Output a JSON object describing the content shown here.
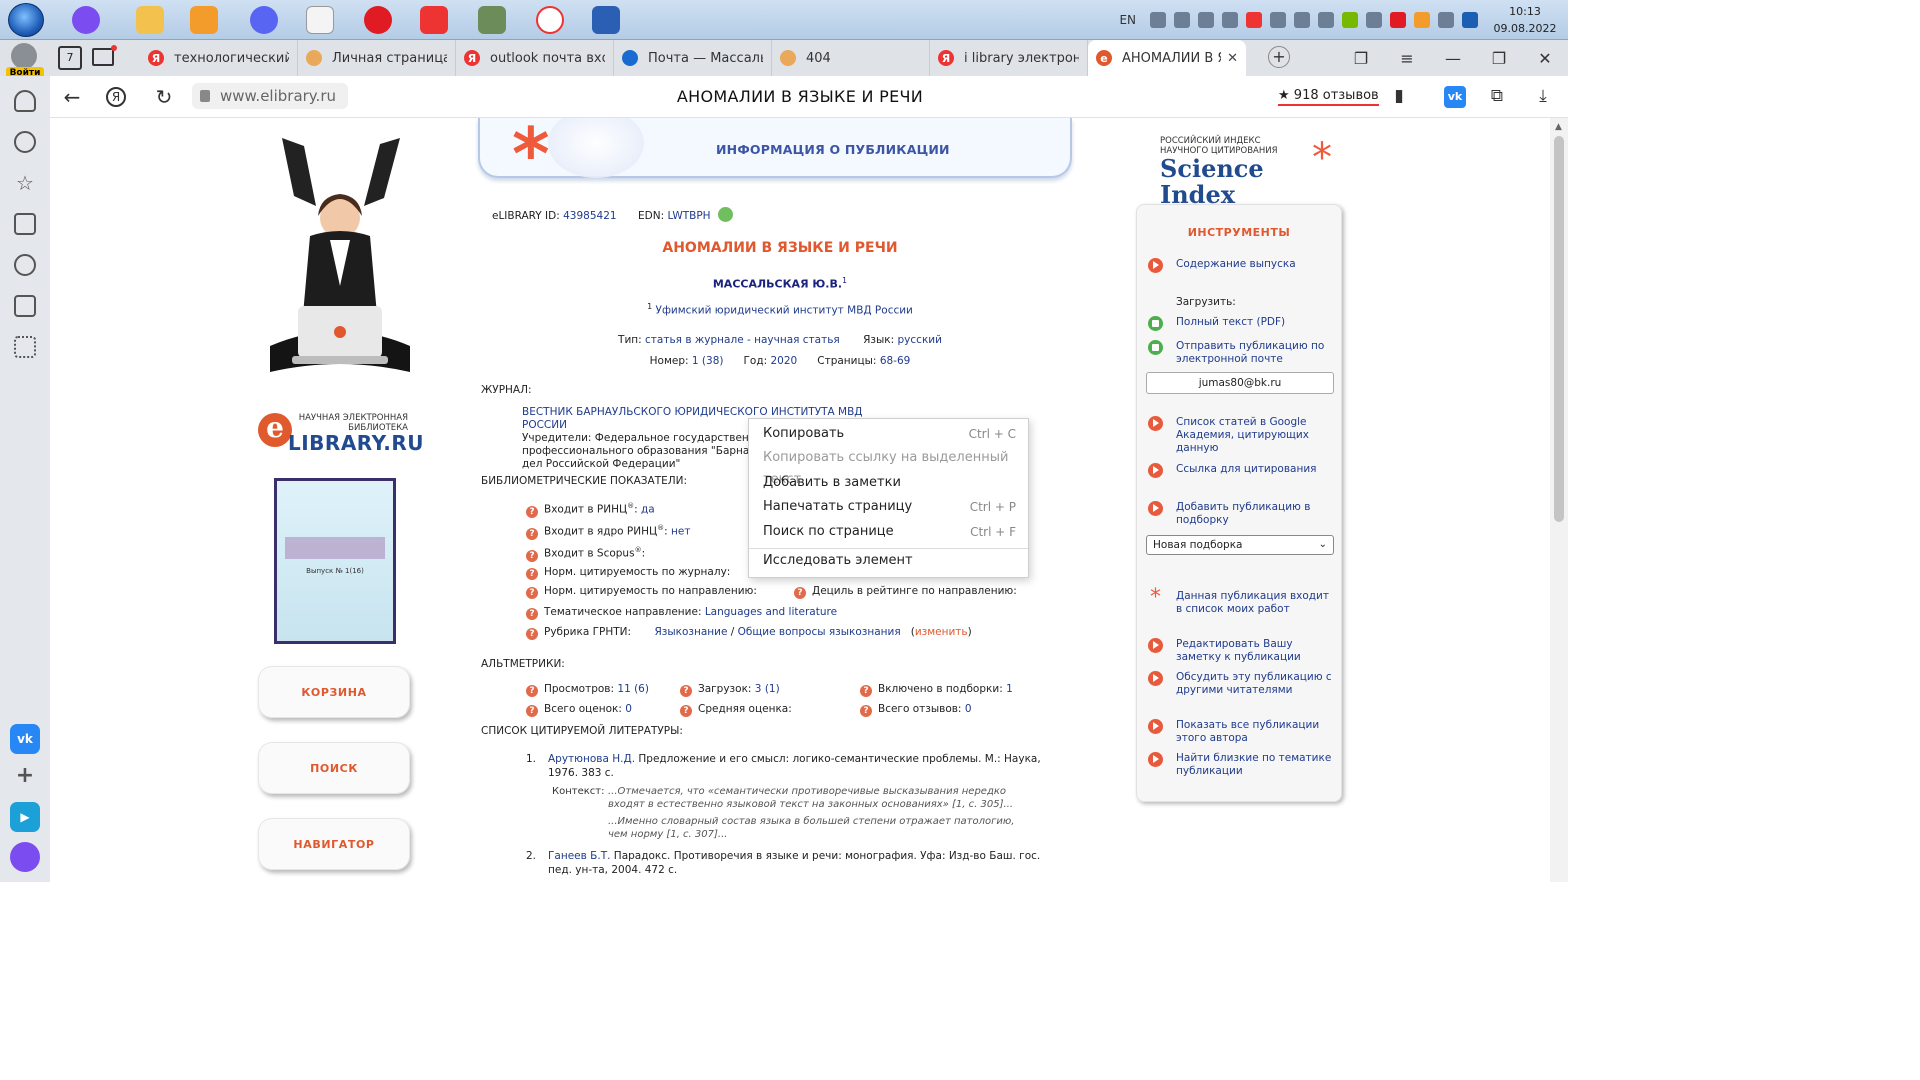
{
  "taskbar": {
    "lang": "EN",
    "time": "10:13",
    "date": "09.08.2022"
  },
  "tabs": [
    {
      "label": "технологический у",
      "fav": "Я",
      "fav_color": "#e33"
    },
    {
      "label": "Личная страница",
      "fav": "",
      "fav_color": "#e9a85a"
    },
    {
      "label": "outlook почта вход",
      "fav": "Я",
      "fav_color": "#e33"
    },
    {
      "label": "Почта — Массальск",
      "fav": "",
      "fav_color": "#1a6bd0"
    },
    {
      "label": "404",
      "fav": "",
      "fav_color": "#e9a85a"
    },
    {
      "label": "i library электронн",
      "fav": "Я",
      "fav_color": "#e33"
    },
    {
      "label": "АНОМАЛИИ В ЯЗЫК",
      "fav": "e",
      "fav_color": "#e0582e"
    }
  ],
  "profile": {
    "login": "Войти"
  },
  "home_badge": "7",
  "address": {
    "url": "www.elibrary.ru",
    "title": "АНОМАЛИИ В ЯЗЫКЕ И РЕЧИ",
    "reviews": "918 отзывов"
  },
  "page": {
    "info_header": "ИНФОРМАЦИЯ О ПУБЛИКАЦИИ",
    "elib_id_label": "eLIBRARY ID:",
    "elib_id": "43985421",
    "edn_label": "EDN:",
    "edn": "LWTBPH",
    "title": "АНОМАЛИИ В ЯЗЫКЕ И РЕЧИ",
    "author": "МАССАЛЬСКАЯ Ю.В.",
    "author_sup": "1",
    "affil_sup": "1",
    "affiliation": "Уфимский юридический институт МВД России",
    "type_label": "Тип:",
    "type": "статья в журнале - научная статья",
    "lang_label": "Язык:",
    "lang": "русский",
    "number_label": "Номер:",
    "number": "1 (38)",
    "year_label": "Год:",
    "year": "2020",
    "pages_label": "Страницы:",
    "pages": "68-69",
    "journal_h": "ЖУРНАЛ:",
    "journal_name": "ВЕСТНИК БАРНАУЛЬСКОГО ЮРИДИЧЕСКОГО ИНСТИТУТА МВД РОССИИ",
    "founders_1": "Учредители: Федеральное государственное",
    "founders_2": "профессионального образования \"Барнаульс",
    "founders_3": "дел Российской Федерации\"",
    "biblio_h": "БИБЛИОМЕТРИЧЕСКИЕ ПОКАЗАТЕЛИ:",
    "rinc_label": "Входит в РИНЦ",
    "rinc": "да",
    "core_label": "Входит в ядро РИНЦ",
    "core": "нет",
    "scopus_label": "Входит в Scopus",
    "norm_journal": "Норм. цитируемость по журналу:",
    "norm_dir": "Норм. цитируемость по направлению:",
    "decile": "Дециль в рейтинге по направлению:",
    "theme_label": "Тематическое направление:",
    "theme": "Languages and literature",
    "grnti_label": "Рубрика ГРНТИ:",
    "grnti_1": "Языкознание",
    "grnti_2": "Общие вопросы языкознания",
    "change": "изменить",
    "alt_h": "АЛЬТМЕТРИКИ:",
    "views_label": "Просмотров:",
    "views": "11 (6)",
    "downloads_label": "Загрузок:",
    "downloads": "3 (1)",
    "collections_label": "Включено в подборки:",
    "collections": "1",
    "ratings_label": "Всего оценок:",
    "ratings": "0",
    "avg_label": "Средняя оценка:",
    "reviews_label": "Всего отзывов:",
    "reviews": "0",
    "refs_h": "СПИСОК ЦИТИРУЕМОЙ ЛИТЕРАТУРЫ:",
    "refs": [
      {
        "num": "1.",
        "author": "Арутюнова Н.Д.",
        "text": "Предложение и его смысл: логико-семантические проблемы. М.: Наука, 1976. 383 с."
      },
      {
        "num": "2.",
        "author": "Ганеев Б.Т.",
        "text": "Парадокс. Противоречия в языке и речи: монография. Уфа: Изд-во Баш. гос. пед. ун-та, 2004. 472 с."
      }
    ],
    "context_label": "Контекст:",
    "context_1": "...Отмечается, что «семантически противоречивые высказывания нередко входят в естественно языковой текст на законных основаниях» [1, с. 305]...",
    "context_2": "...Именно словарный состав языка в большей степени отражает патологию, чем норму [1, с. 307]..."
  },
  "left": {
    "elib_sub": "НАУЧНАЯ ЭЛЕКТРОННАЯ БИБЛИОТЕКА",
    "elib_name": "LIBRARY.RU",
    "cover_text": "Выпуск № 1(16)",
    "btn_cart": "КОРЗИНА",
    "btn_search": "ПОИСК",
    "btn_nav": "НАВИГАТОР"
  },
  "right": {
    "si_sub": "РОССИЙСКИЙ ИНДЕКС НАУЧНОГО ЦИТИРОВАНИЯ",
    "si_name": "Science Index",
    "tools_h": "ИНСТРУМЕНТЫ",
    "issue": "Содержание выпуска",
    "download_label": "Загрузить:",
    "fulltext": "Полный текст (PDF)",
    "send": "Отправить публикацию по электронной почте",
    "email": "jumas80@bk.ru",
    "google": "Список статей в Google Академия, цитирующих данную",
    "cite": "Ссылка для цитирования",
    "add_coll": "Добавить публикацию в подборку",
    "select": "Новая подборка",
    "in_my": "Данная публикация входит в список моих работ",
    "edit_note": "Редактировать Вашу заметку к публикации",
    "discuss": "Обсудить эту публикацию с другими читателями",
    "all_pubs": "Показать все публикации этого автора",
    "similar": "Найти близкие по тематике публикации"
  },
  "context_menu": {
    "copy": "Копировать",
    "copy_sc": "Ctrl + C",
    "copy_link": "Копировать ссылку на выделенный текст",
    "add_notes": "Добавить в заметки",
    "print": "Напечатать страницу",
    "print_sc": "Ctrl + P",
    "find": "Поиск по странице",
    "find_sc": "Ctrl + F",
    "inspect": "Исследовать элемент"
  },
  "colors": {
    "accent": "#e0582e",
    "link": "#1f3b8c",
    "brand": "#224a8f"
  }
}
